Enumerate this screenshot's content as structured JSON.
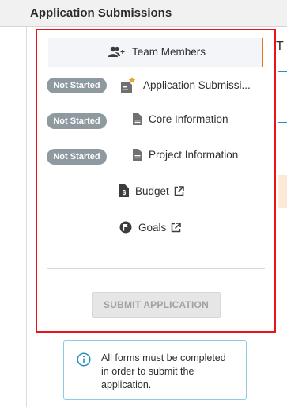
{
  "header": {
    "title": "Application Submissions"
  },
  "nav": {
    "team_members": "Team Members",
    "application_submissions": "Application Submissi...",
    "core_information": "Core Information",
    "project_information": "Project Information",
    "budget": "Budget",
    "goals": "Goals"
  },
  "badges": {
    "not_started": "Not Started"
  },
  "submit_label": "SUBMIT APPLICATION",
  "info_text": "All forms must be completed in order to submit the application.",
  "right_peek": "T",
  "colors": {
    "highlight_border": "#e8141b",
    "active_indicator": "#e7771e",
    "badge_bg": "#8f9aa0",
    "info_border": "#8ec9e6",
    "star": "#f0a030"
  }
}
